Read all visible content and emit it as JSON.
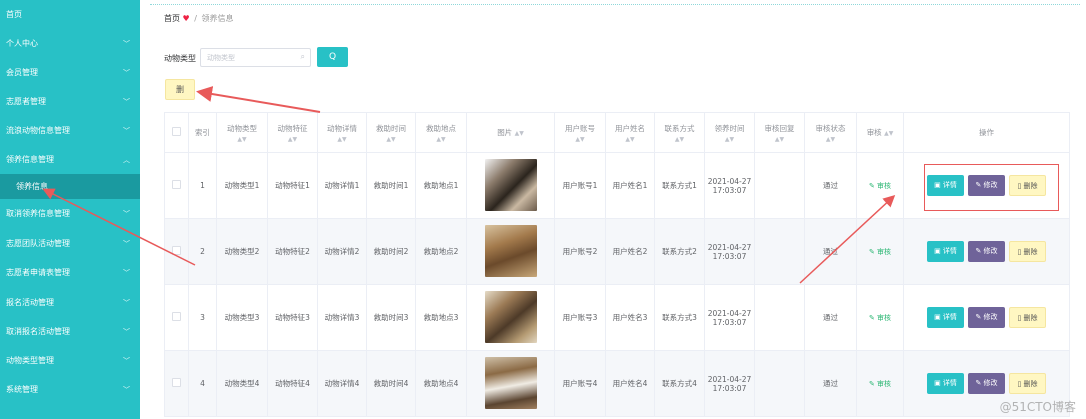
{
  "sidebar": {
    "items": [
      {
        "label": "首页",
        "chevron": false
      },
      {
        "label": "个人中心",
        "chevron": true
      },
      {
        "label": "会员管理",
        "chevron": true
      },
      {
        "label": "志愿者管理",
        "chevron": true
      },
      {
        "label": "流浪动物信息管理",
        "chevron": true
      },
      {
        "label": "领养信息管理",
        "chevron": true,
        "open": true
      },
      {
        "label": "领养信息",
        "sub": true
      },
      {
        "label": "取消领养信息管理",
        "chevron": true
      },
      {
        "label": "志愿团队活动管理",
        "chevron": true
      },
      {
        "label": "志愿者申请表管理",
        "chevron": true
      },
      {
        "label": "报名活动管理",
        "chevron": true
      },
      {
        "label": "取消报名活动管理",
        "chevron": true
      },
      {
        "label": "动物类型管理",
        "chevron": true
      },
      {
        "label": "系统管理",
        "chevron": true
      }
    ]
  },
  "breadcrumb": {
    "home": "首页",
    "sep": "/",
    "current": "领养信息"
  },
  "search": {
    "label": "动物类型",
    "placeholder": "动物类型",
    "button": "Q"
  },
  "toolbar": {
    "delete_label": "删"
  },
  "table": {
    "headers": [
      "索引",
      "动物类型",
      "动物特征",
      "动物详情",
      "救助时间",
      "救助地点",
      "图片",
      "用户账号",
      "用户姓名",
      "联系方式",
      "领养时间",
      "审核回复",
      "审核状态",
      "审核",
      "操作"
    ],
    "rows": [
      {
        "index": "1",
        "type": "动物类型1",
        "feature": "动物特征1",
        "detail": "动物详情1",
        "time": "救助时间1",
        "place": "救助地点1",
        "account": "用户账号1",
        "name": "用户姓名1",
        "contact": "联系方式1",
        "adopt_time": "2021-04-27 17:03:07",
        "reply": "",
        "status": "通过",
        "audit": "审核"
      },
      {
        "index": "2",
        "type": "动物类型2",
        "feature": "动物特征2",
        "detail": "动物详情2",
        "time": "救助时间2",
        "place": "救助地点2",
        "account": "用户账号2",
        "name": "用户姓名2",
        "contact": "联系方式2",
        "adopt_time": "2021-04-27 17:03:07",
        "reply": "",
        "status": "通过",
        "audit": "审核"
      },
      {
        "index": "3",
        "type": "动物类型3",
        "feature": "动物特征3",
        "detail": "动物详情3",
        "time": "救助时间3",
        "place": "救助地点3",
        "account": "用户账号3",
        "name": "用户姓名3",
        "contact": "联系方式3",
        "adopt_time": "2021-04-27 17:03:07",
        "reply": "",
        "status": "通过",
        "audit": "审核"
      },
      {
        "index": "4",
        "type": "动物类型4",
        "feature": "动物特征4",
        "detail": "动物详情4",
        "time": "救助时间4",
        "place": "救助地点4",
        "account": "用户账号4",
        "name": "用户姓名4",
        "contact": "联系方式4",
        "adopt_time": "2021-04-27 17:03:07",
        "reply": "",
        "status": "通过",
        "audit": "审核"
      }
    ],
    "actions": {
      "detail": "详情",
      "edit": "修改",
      "remove": "删除"
    }
  },
  "watermark": "@51CTO博客",
  "colors": {
    "sidebar": "#28c1c6",
    "sidebar_active": "#1a9aa0",
    "edit": "#6f6399",
    "delete": "#fff7c2",
    "annotation": "#e85a5a"
  }
}
